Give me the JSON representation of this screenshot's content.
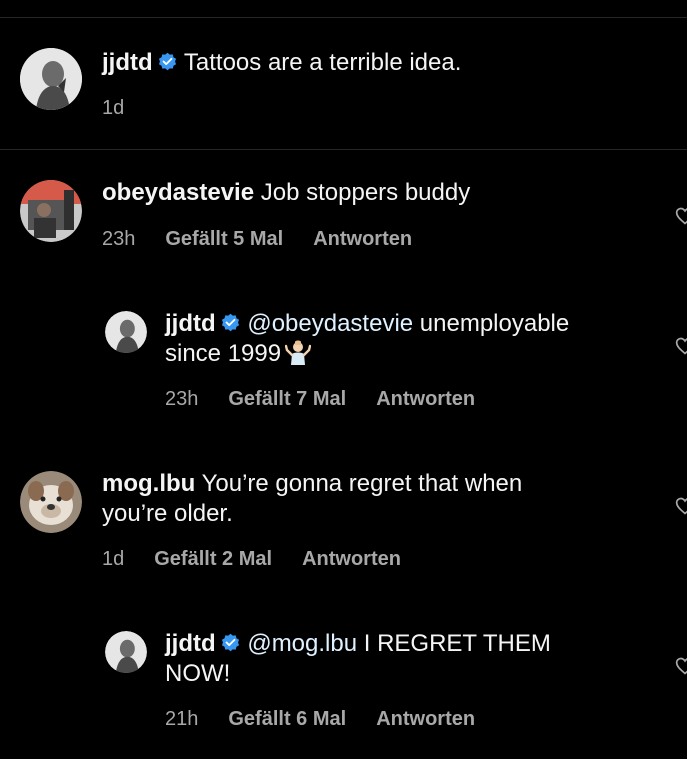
{
  "comments": [
    {
      "username": "jjdtd",
      "verified": true,
      "text": "Tattoos are a terrible idea.",
      "time": "1d"
    },
    {
      "username": "obeydastevie",
      "verified": false,
      "text": "Job stoppers buddy",
      "time": "23h",
      "likes": "Gefällt 5 Mal",
      "reply": "Antworten"
    },
    {
      "username": "jjdtd",
      "verified": true,
      "mention": "@obeydastevie",
      "text_line1": "unemployable",
      "text_line2": "since 1999",
      "emoji": "person-shrugging",
      "time": "23h",
      "likes": "Gefällt 7 Mal",
      "reply": "Antworten"
    },
    {
      "username": "mog.lbu",
      "verified": false,
      "text_line1": "You’re gonna regret that when",
      "text_line2": "you’re older.",
      "time": "1d",
      "likes": "Gefällt 2 Mal",
      "reply": "Antworten"
    },
    {
      "username": "jjdtd",
      "verified": true,
      "mention": "@mog.lbu",
      "text_line1": "I REGRET THEM",
      "text_line2": "NOW!",
      "time": "21h",
      "likes": "Gefällt 6 Mal",
      "reply": "Antworten"
    }
  ],
  "colors": {
    "background": "#000000",
    "text": "#f5f5f5",
    "secondary": "#a8a8a8",
    "verified": "#3897f0",
    "mention": "#e0f1ff"
  }
}
